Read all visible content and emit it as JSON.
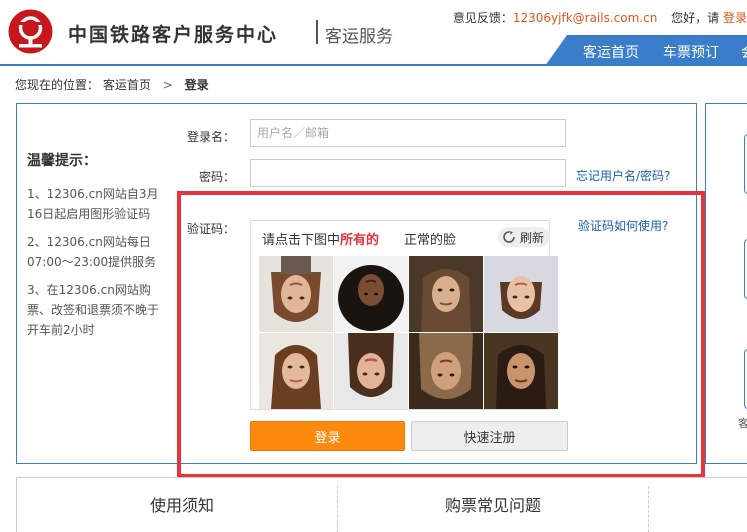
{
  "header": {
    "logo_title": "中国铁路客户服务中心",
    "logo_sub": "客运服务",
    "feedback_label": "意见反馈：",
    "feedback_email": "12306yjfk@rails.com.cn",
    "greeting": "您好，请",
    "login_link": "登录",
    "nav": [
      "客运首页",
      "车票预订",
      "会"
    ]
  },
  "breadcrumb": {
    "prefix": "您现在的位置：",
    "home": "客运首页",
    "separator": ">",
    "current": "登录"
  },
  "tips": {
    "title": "温馨提示：",
    "items": [
      "1、12306.cn网站自3月16日起启用图形验证码",
      "2、12306.cn网站每日07:00～23:00提供服务",
      "3、在12306.cn网站购票、改签和退票须不晚于开车前2小时"
    ]
  },
  "form": {
    "username_label": "登录名：",
    "username_placeholder": "用户名／邮箱",
    "password_label": "密码：",
    "forgot_link": "忘记用户名/密码?",
    "captcha_label": "验证码：",
    "captcha_help_link": "验证码如何使用?",
    "login_button": "登录",
    "register_button": "快速注册"
  },
  "captcha": {
    "prompt_pre": "请点击下图中",
    "prompt_highlight": "所有的",
    "prompt_target": "正常的脸",
    "refresh_label": "刷新",
    "tiles": [
      {
        "id": "tile-1",
        "desc": "face upside down"
      },
      {
        "id": "tile-2",
        "desc": "face upside down curly hair"
      },
      {
        "id": "tile-3",
        "desc": "face upright"
      },
      {
        "id": "tile-4",
        "desc": "face upside down"
      },
      {
        "id": "tile-5",
        "desc": "face upright"
      },
      {
        "id": "tile-6",
        "desc": "face upside down"
      },
      {
        "id": "tile-7",
        "desc": "face upside down"
      },
      {
        "id": "tile-8",
        "desc": "face upright"
      }
    ]
  },
  "right_panel": {
    "text": "客"
  },
  "bottom": {
    "notice_title": "使用须知",
    "faq_title": "购票常见问题"
  },
  "colors": {
    "accent_blue": "#3a7dc9",
    "login_orange": "#fb8a0e",
    "highlight_red": "#e8333b",
    "link_orange": "#e0561b"
  }
}
